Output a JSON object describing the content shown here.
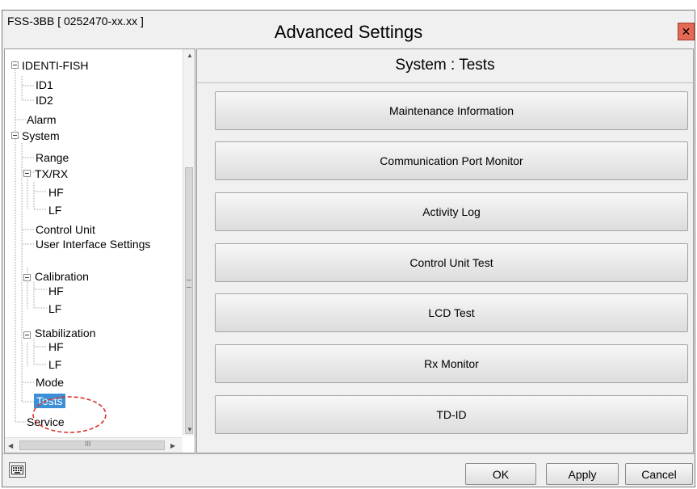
{
  "window": {
    "device_id": "FSS-3BB [ 0252470-xx.xx ]",
    "title": "Advanced Settings",
    "close_symbol": "✕"
  },
  "tree": {
    "identi_fish": "IDENTI-FISH",
    "id1": "ID1",
    "id2": "ID2",
    "alarm": "Alarm",
    "system": "System",
    "range": "Range",
    "txrx": "TX/RX",
    "txrx_hf": "HF",
    "txrx_lf": "LF",
    "control_unit": "Control Unit",
    "ui_settings": "User Interface Settings",
    "calibration": "Calibration",
    "cal_hf": "HF",
    "cal_lf": "LF",
    "stabilization": "Stabilization",
    "stab_hf": "HF",
    "stab_lf": "LF",
    "mode": "Mode",
    "tests": "Tests",
    "service": "Service",
    "hscroll_grip": "III"
  },
  "content": {
    "title": "System : Tests",
    "buttons": [
      "Maintenance Information",
      "Communication Port Monitor",
      "Activity Log",
      "Control Unit Test",
      "LCD Test",
      "Rx Monitor",
      "TD-ID"
    ]
  },
  "footer": {
    "ok": "OK",
    "apply": "Apply",
    "cancel": "Cancel"
  },
  "icons": {
    "close": "close-icon",
    "keyboard": "keyboard-icon"
  },
  "colors": {
    "selection": "#3a8fd6",
    "close_button": "#e46a55",
    "annotation": "#d9342b"
  }
}
